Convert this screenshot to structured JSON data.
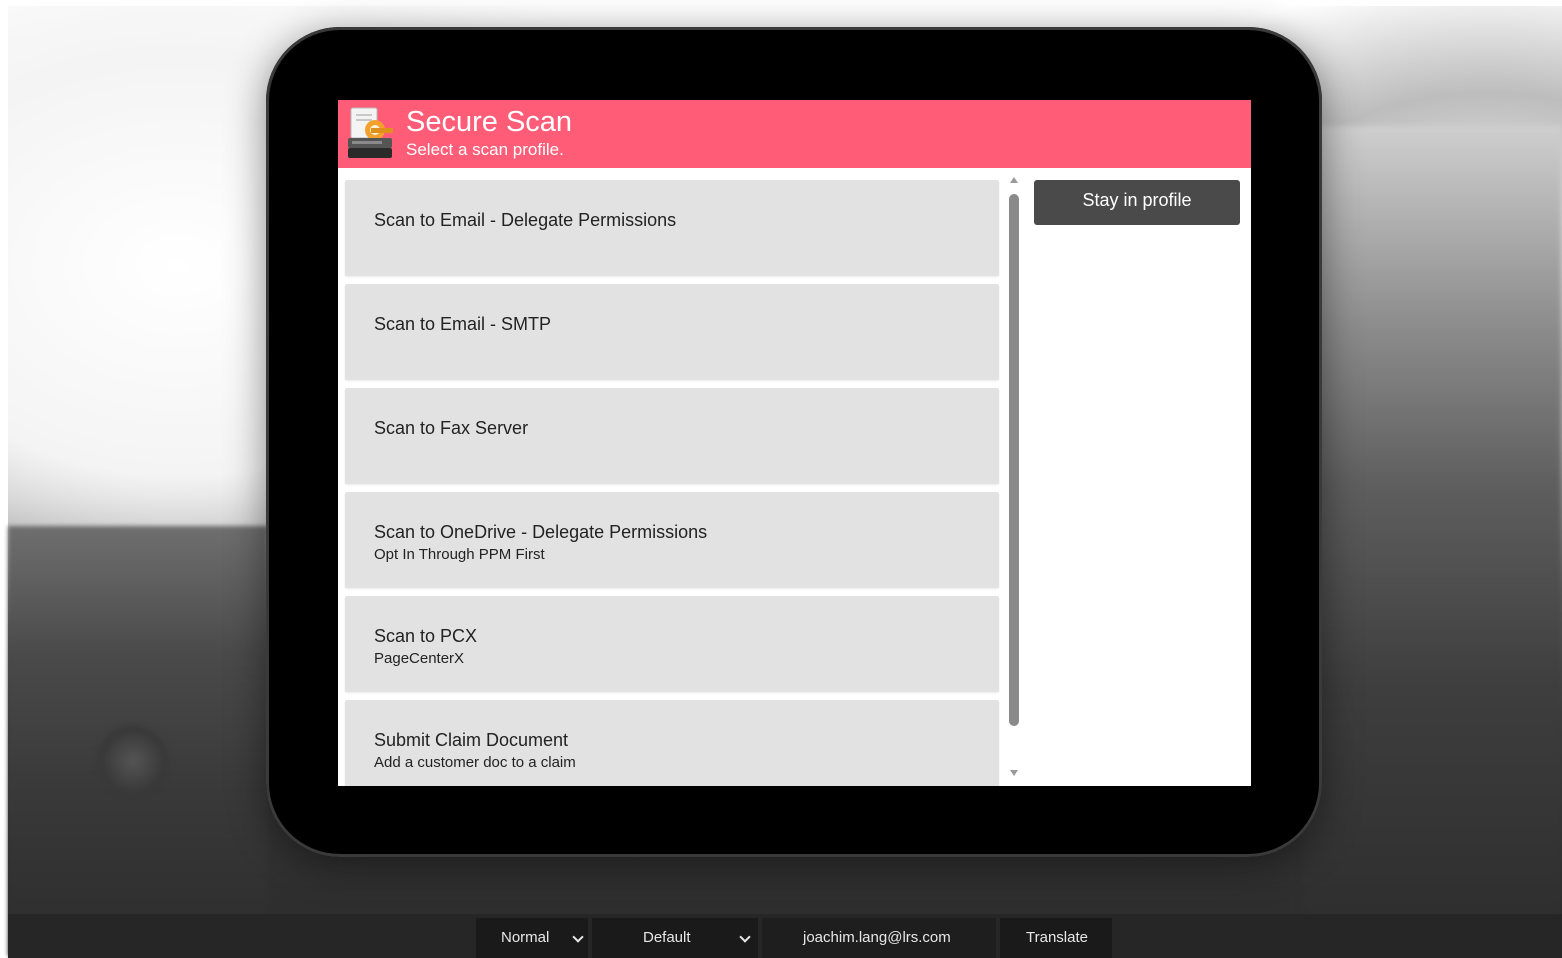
{
  "app": {
    "title": "Secure Scan",
    "subtitle": "Select a scan profile."
  },
  "profiles": [
    {
      "label": "Scan to Email - Delegate Permissions",
      "sub": ""
    },
    {
      "label": "Scan to Email - SMTP",
      "sub": ""
    },
    {
      "label": "Scan to Fax Server",
      "sub": ""
    },
    {
      "label": "Scan to OneDrive - Delegate Permissions",
      "sub": "Opt In Through PPM First"
    },
    {
      "label": "Scan to PCX",
      "sub": "PageCenterX"
    },
    {
      "label": "Submit Claim Document",
      "sub": "Add a customer doc to a claim"
    }
  ],
  "actions": {
    "stay_in_profile": "Stay in profile"
  },
  "footer": {
    "mode": "Normal",
    "theme": "Default",
    "user_email": "joachim.lang@lrs.com",
    "translate": "Translate"
  },
  "colors": {
    "header": "#ff5c77",
    "item_bg": "#e2e2e2",
    "button_bg": "#4a4a4a"
  },
  "icons": {
    "app": "scanner-lock-icon",
    "scroll_up": "triangle-up-icon",
    "scroll_down": "triangle-down-icon",
    "dropdown": "chevron-down-icon"
  }
}
